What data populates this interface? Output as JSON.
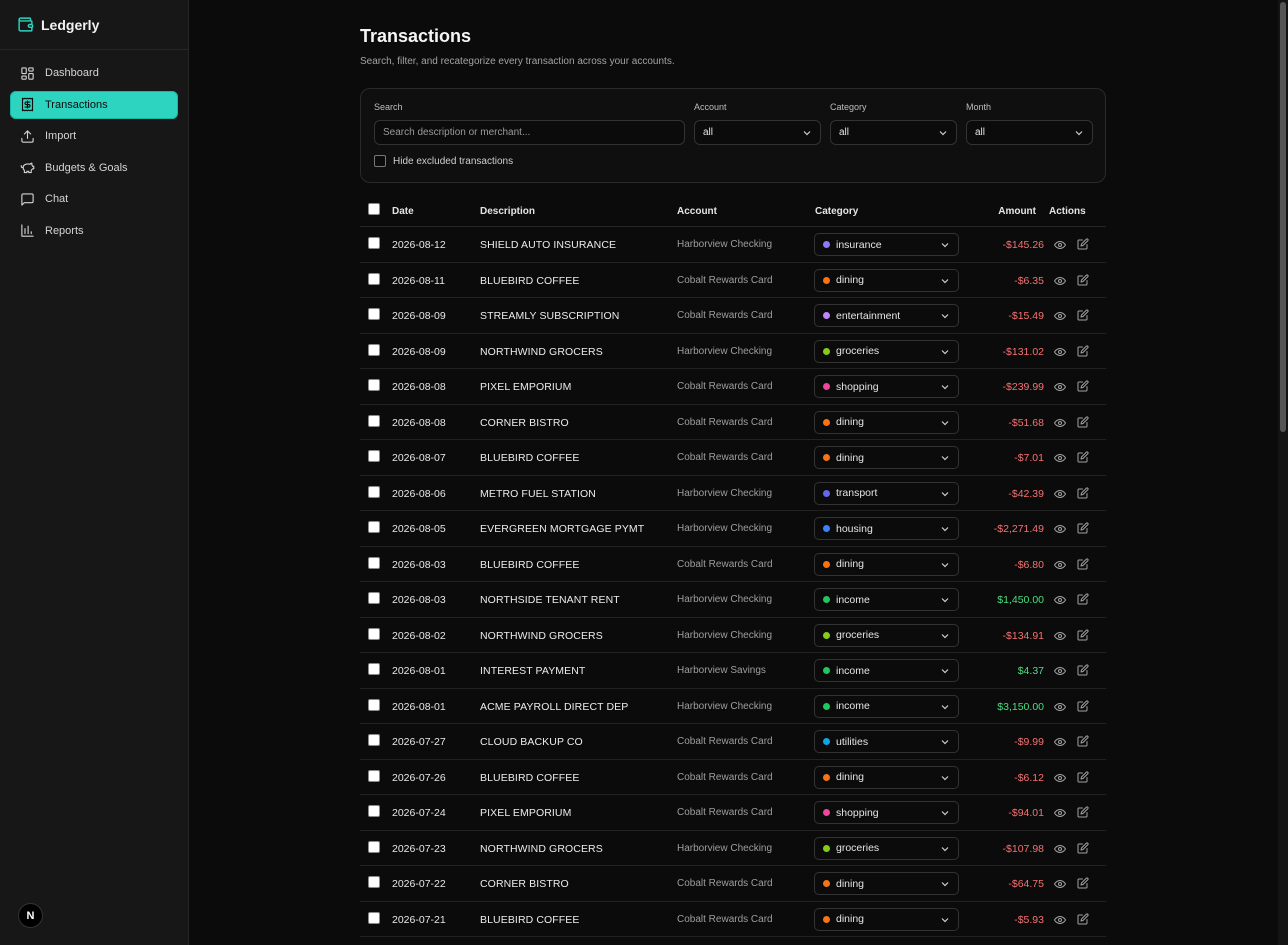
{
  "app": {
    "name": "Ledgerly"
  },
  "sidebar": {
    "items": [
      {
        "label": "Dashboard",
        "icon": "dashboard-grid-icon",
        "active": false
      },
      {
        "label": "Transactions",
        "icon": "receipt-dollar-icon",
        "active": true
      },
      {
        "label": "Import",
        "icon": "upload-icon",
        "active": false
      },
      {
        "label": "Budgets & Goals",
        "icon": "piggy-bank-icon",
        "active": false
      },
      {
        "label": "Chat",
        "icon": "chat-bubble-icon",
        "active": false
      },
      {
        "label": "Reports",
        "icon": "bar-chart-icon",
        "active": false
      }
    ],
    "avatar": "N"
  },
  "page": {
    "title": "Transactions",
    "subtitle": "Search, filter, and recategorize every transaction across your accounts."
  },
  "filters": {
    "search_label": "Search",
    "search_placeholder": "Search description or merchant...",
    "search_value": "",
    "account_label": "Account",
    "account_value": "all",
    "category_label": "Category",
    "category_value": "all",
    "month_label": "Month",
    "month_value": "all",
    "hide_excluded_label": "Hide excluded transactions",
    "hide_excluded_checked": false
  },
  "table": {
    "headers": {
      "date": "Date",
      "description": "Description",
      "account": "Account",
      "category": "Category",
      "amount": "Amount",
      "actions": "Actions"
    },
    "rows": [
      {
        "date": "2026-08-12",
        "description": "SHIELD AUTO INSURANCE",
        "account": "Harborview Checking",
        "category": "insurance",
        "color": "#8b7cf6",
        "amount": "-$145.26"
      },
      {
        "date": "2026-08-11",
        "description": "BLUEBIRD COFFEE",
        "account": "Cobalt Rewards Card",
        "category": "dining",
        "color": "#f97316",
        "amount": "-$6.35"
      },
      {
        "date": "2026-08-09",
        "description": "STREAMLY SUBSCRIPTION",
        "account": "Cobalt Rewards Card",
        "category": "entertainment",
        "color": "#c084fc",
        "amount": "-$15.49"
      },
      {
        "date": "2026-08-09",
        "description": "NORTHWIND GROCERS",
        "account": "Harborview Checking",
        "category": "groceries",
        "color": "#84cc16",
        "amount": "-$131.02"
      },
      {
        "date": "2026-08-08",
        "description": "PIXEL EMPORIUM",
        "account": "Cobalt Rewards Card",
        "category": "shopping",
        "color": "#ec4899",
        "amount": "-$239.99"
      },
      {
        "date": "2026-08-08",
        "description": "CORNER BISTRO",
        "account": "Cobalt Rewards Card",
        "category": "dining",
        "color": "#f97316",
        "amount": "-$51.68"
      },
      {
        "date": "2026-08-07",
        "description": "BLUEBIRD COFFEE",
        "account": "Cobalt Rewards Card",
        "category": "dining",
        "color": "#f97316",
        "amount": "-$7.01"
      },
      {
        "date": "2026-08-06",
        "description": "METRO FUEL STATION",
        "account": "Harborview Checking",
        "category": "transport",
        "color": "#6366f1",
        "amount": "-$42.39"
      },
      {
        "date": "2026-08-05",
        "description": "EVERGREEN MORTGAGE PYMT",
        "account": "Harborview Checking",
        "category": "housing",
        "color": "#3b82f6",
        "amount": "-$2,271.49"
      },
      {
        "date": "2026-08-03",
        "description": "BLUEBIRD COFFEE",
        "account": "Cobalt Rewards Card",
        "category": "dining",
        "color": "#f97316",
        "amount": "-$6.80"
      },
      {
        "date": "2026-08-03",
        "description": "NORTHSIDE TENANT RENT",
        "account": "Harborview Checking",
        "category": "income",
        "color": "#22c55e",
        "amount": "$1,450.00"
      },
      {
        "date": "2026-08-02",
        "description": "NORTHWIND GROCERS",
        "account": "Harborview Checking",
        "category": "groceries",
        "color": "#84cc16",
        "amount": "-$134.91"
      },
      {
        "date": "2026-08-01",
        "description": "INTEREST PAYMENT",
        "account": "Harborview Savings",
        "category": "income",
        "color": "#22c55e",
        "amount": "$4.37"
      },
      {
        "date": "2026-08-01",
        "description": "ACME PAYROLL DIRECT DEP",
        "account": "Harborview Checking",
        "category": "income",
        "color": "#22c55e",
        "amount": "$3,150.00"
      },
      {
        "date": "2026-07-27",
        "description": "CLOUD BACKUP CO",
        "account": "Cobalt Rewards Card",
        "category": "utilities",
        "color": "#0ea5e9",
        "amount": "-$9.99"
      },
      {
        "date": "2026-07-26",
        "description": "BLUEBIRD COFFEE",
        "account": "Cobalt Rewards Card",
        "category": "dining",
        "color": "#f97316",
        "amount": "-$6.12"
      },
      {
        "date": "2026-07-24",
        "description": "PIXEL EMPORIUM",
        "account": "Cobalt Rewards Card",
        "category": "shopping",
        "color": "#ec4899",
        "amount": "-$94.01"
      },
      {
        "date": "2026-07-23",
        "description": "NORTHWIND GROCERS",
        "account": "Harborview Checking",
        "category": "groceries",
        "color": "#84cc16",
        "amount": "-$107.98"
      },
      {
        "date": "2026-07-22",
        "description": "CORNER BISTRO",
        "account": "Cobalt Rewards Card",
        "category": "dining",
        "color": "#f97316",
        "amount": "-$64.75"
      },
      {
        "date": "2026-07-21",
        "description": "BLUEBIRD COFFEE",
        "account": "Cobalt Rewards Card",
        "category": "dining",
        "color": "#f97316",
        "amount": "-$5.93"
      }
    ]
  },
  "colors": {
    "accent": "#2dd4bf",
    "negative": "#f87171",
    "positive": "#4ade80",
    "background": "#0b0b0b",
    "sidebar": "#171717"
  }
}
